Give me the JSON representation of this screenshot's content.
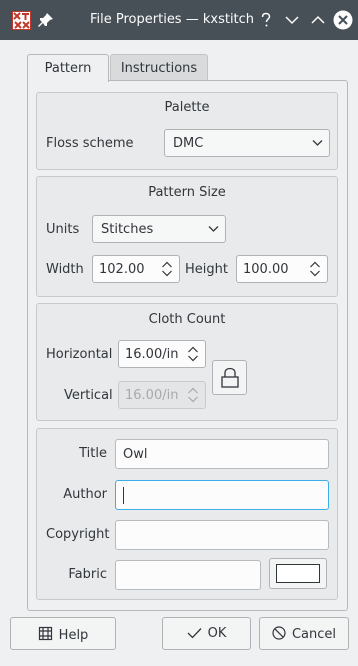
{
  "window": {
    "title": "File Properties — kxstitch",
    "icons": [
      "kxstitch-app-icon",
      "pin-icon",
      "help-question-icon",
      "minimize-icon",
      "maximize-icon",
      "close-icon"
    ]
  },
  "tabs": [
    {
      "label": "Pattern",
      "active": true
    },
    {
      "label": "Instructions",
      "active": false
    }
  ],
  "palette": {
    "title": "Palette",
    "floss_label": "Floss scheme",
    "floss_value": "DMC"
  },
  "pattern_size": {
    "title": "Pattern Size",
    "units_label": "Units",
    "units_value": "Stitches",
    "width_label": "Width",
    "width_value": "102.00",
    "height_label": "Height",
    "height_value": "100.00"
  },
  "cloth_count": {
    "title": "Cloth Count",
    "horizontal_label": "Horizontal",
    "horizontal_value": "16.00/in",
    "vertical_label": "Vertical",
    "vertical_value": "16.00/in",
    "vertical_enabled": false,
    "lock_icon": "lock-icon"
  },
  "info": {
    "title_label": "Title",
    "title_value": "Owl",
    "author_label": "Author",
    "author_value": "",
    "copyright_label": "Copyright",
    "copyright_value": "",
    "fabric_label": "Fabric",
    "fabric_value": "",
    "fabric_color": "#ffffff"
  },
  "buttons": {
    "help": "Help",
    "ok": "OK",
    "cancel": "Cancel"
  },
  "colors": {
    "titlebar": "#475057",
    "window_bg": "#eff0f1",
    "focus": "#3daee9",
    "text": "#31363b"
  }
}
